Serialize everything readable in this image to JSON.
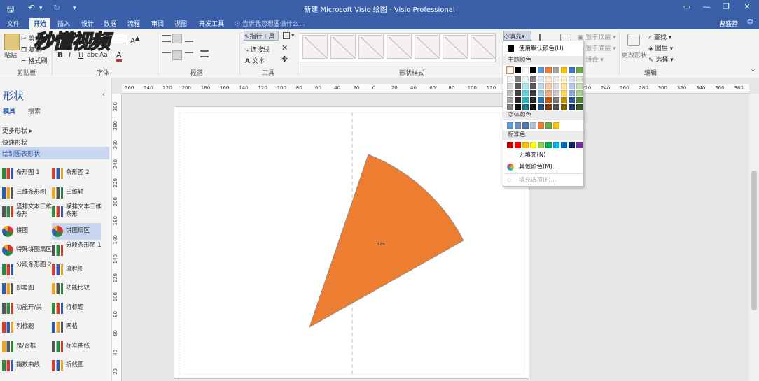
{
  "titlebar": {
    "title": "新建 Microsoft Visio 绘图  -  Visio Professional",
    "save_icon": "save-icon",
    "undo_icon": "undo-icon",
    "redo_icon": "redo-icon",
    "customize_icon": "customize-icon",
    "minimize": "—",
    "restore": "❐",
    "close": "✕",
    "ribbon_opts": "▭"
  },
  "tabs": [
    "文件",
    "开始",
    "插入",
    "设计",
    "数据",
    "流程",
    "审阅",
    "视图",
    "开发工具"
  ],
  "active_tab": "开始",
  "tell_me": "告诉我您想要做什么...",
  "user_name": "曹盛营",
  "watermark": "秒懂视频",
  "ribbon": {
    "clipboard": {
      "label": "剪贴板",
      "paste": "粘贴",
      "cut": "剪切",
      "copy": "复制",
      "format_painter": "格式刷"
    },
    "font": {
      "label": "字体",
      "bold": "B",
      "italic": "I",
      "underline": "U",
      "strike": "abc",
      "size": "Aa",
      "color": "A"
    },
    "paragraph": {
      "label": "段落"
    },
    "tools": {
      "label": "工具",
      "pointer": "指针工具",
      "connector": "连接线",
      "text": "文本"
    },
    "shape_styles": {
      "label": "形状样式",
      "swatch_count": 7
    },
    "fill": "填充",
    "arrange": {
      "bring_front": "置于顶层",
      "send_back": "置于底层",
      "group": "组合"
    },
    "change_shape": "更改形状",
    "editing": {
      "label": "编辑",
      "find": "查找",
      "layers": "图层",
      "select": "选择"
    }
  },
  "fill_menu": {
    "default_color": "使用默认颜色(U)",
    "theme_colors_head": "主题颜色",
    "theme_top": [
      "#ffffff",
      "#000000",
      "#ffffff",
      "#000000",
      "#5b9bd5",
      "#ed7d31",
      "#a5a5a5",
      "#ffc000",
      "#4472c4",
      "#70ad47"
    ],
    "theme_shades": [
      [
        "#f2f2f2",
        "#d9d9d9",
        "#bfbfbf",
        "#a6a6a6",
        "#7f7f7f"
      ],
      [
        "#7f7f7f",
        "#595959",
        "#3f3f3f",
        "#262626",
        "#0d0d0d"
      ],
      [
        "#e7f9fb",
        "#aee7ef",
        "#5fd1df",
        "#2bb4c6",
        "#1a7e8a"
      ],
      [
        "#7f7f7f",
        "#595959",
        "#3f3f3f",
        "#262626",
        "#0d0d0d"
      ],
      [
        "#deebf7",
        "#bdd7ee",
        "#9cc2e5",
        "#2e75b6",
        "#1f4e79"
      ],
      [
        "#fbe5d6",
        "#f8cbad",
        "#f4b183",
        "#c55a11",
        "#843c0c"
      ],
      [
        "#ededed",
        "#dbdbdb",
        "#c9c9c9",
        "#7b7b7b",
        "#525252"
      ],
      [
        "#fff2cc",
        "#ffe699",
        "#ffd966",
        "#bf9000",
        "#7f6000"
      ],
      [
        "#dae3f3",
        "#b4c7e7",
        "#8faadc",
        "#2f5597",
        "#203864"
      ],
      [
        "#e2f0d9",
        "#c5e0b4",
        "#a9d18e",
        "#548235",
        "#385723"
      ]
    ],
    "variant_head": "变体颜色",
    "variant_colors": [
      "#5b9bd5",
      "#6f8fc0",
      "#4e7bb0",
      "#b0c4de",
      "#ed7d31",
      "#70ad47",
      "#ffc000"
    ],
    "standard_head": "标准色",
    "standard_colors": [
      "#c00000",
      "#ff0000",
      "#ffc000",
      "#ffff00",
      "#92d050",
      "#00b050",
      "#00b0f0",
      "#0070c0",
      "#002060",
      "#7030a0"
    ],
    "no_fill": "无填充(N)",
    "more_colors": "其他颜色(M)...",
    "fill_options": "填充选项(F)..."
  },
  "shapes_pane": {
    "title": "形状",
    "tab_stencils": "模具",
    "tab_search": "搜索",
    "more_shapes": "更多形状",
    "quick_shapes": "快速形状",
    "section": "绘制图表形状",
    "items": [
      {
        "label": "条形图 1",
        "icon": "bar-chart-icon"
      },
      {
        "label": "条形图 2",
        "icon": "bar-chart-icon"
      },
      {
        "label": "三维条形图",
        "icon": "3d-bar-chart-icon"
      },
      {
        "label": "三维轴",
        "icon": "3d-axis-icon"
      },
      {
        "label": "竖排文本三维条形",
        "icon": "vertical-text-bar-icon"
      },
      {
        "label": "横排文本三维条形",
        "icon": "horizontal-text-bar-icon"
      },
      {
        "label": "饼图",
        "icon": "pie-chart-icon"
      },
      {
        "label": "饼图扇区",
        "icon": "pie-sector-icon"
      },
      {
        "label": "特殊饼图扇区",
        "icon": "special-pie-sector-icon"
      },
      {
        "label": "分段条形图 1",
        "icon": "segmented-bar-icon"
      },
      {
        "label": "分段条形图 2",
        "icon": "segmented-bar-icon"
      },
      {
        "label": "流程图",
        "icon": "flowchart-icon"
      },
      {
        "label": "部署图",
        "icon": "deployment-icon"
      },
      {
        "label": "功能比较",
        "icon": "feature-compare-icon"
      },
      {
        "label": "功能开/关",
        "icon": "feature-toggle-icon"
      },
      {
        "label": "行标题",
        "icon": "row-header-icon"
      },
      {
        "label": "列标题",
        "icon": "column-header-icon"
      },
      {
        "label": "网格",
        "icon": "grid-icon"
      },
      {
        "label": "是/否框",
        "icon": "yes-no-box-icon"
      },
      {
        "label": "标准曲线",
        "icon": "normal-curve-icon"
      },
      {
        "label": "指数曲线",
        "icon": "exponential-curve-icon"
      },
      {
        "label": "折线图",
        "icon": "line-chart-icon"
      }
    ],
    "selected_item": "饼图扇区"
  },
  "rulers": {
    "h_labels": [
      "260",
      "240",
      "220",
      "200",
      "180",
      "160",
      "140",
      "120",
      "100",
      "80",
      "60",
      "40",
      "20",
      "0",
      "20",
      "40",
      "60",
      "80",
      "100",
      "120",
      "140",
      "160",
      "180",
      "200",
      "220",
      "240",
      "260",
      "280",
      "300",
      "320",
      "340",
      "360",
      "380"
    ],
    "v_labels": [
      "300",
      "280",
      "260",
      "240",
      "220",
      "200",
      "180",
      "160",
      "140",
      "120",
      "100",
      "80",
      "60",
      "40",
      "20"
    ]
  },
  "canvas": {
    "sector_fill": "#ed7d31",
    "sector_label": "12%"
  }
}
